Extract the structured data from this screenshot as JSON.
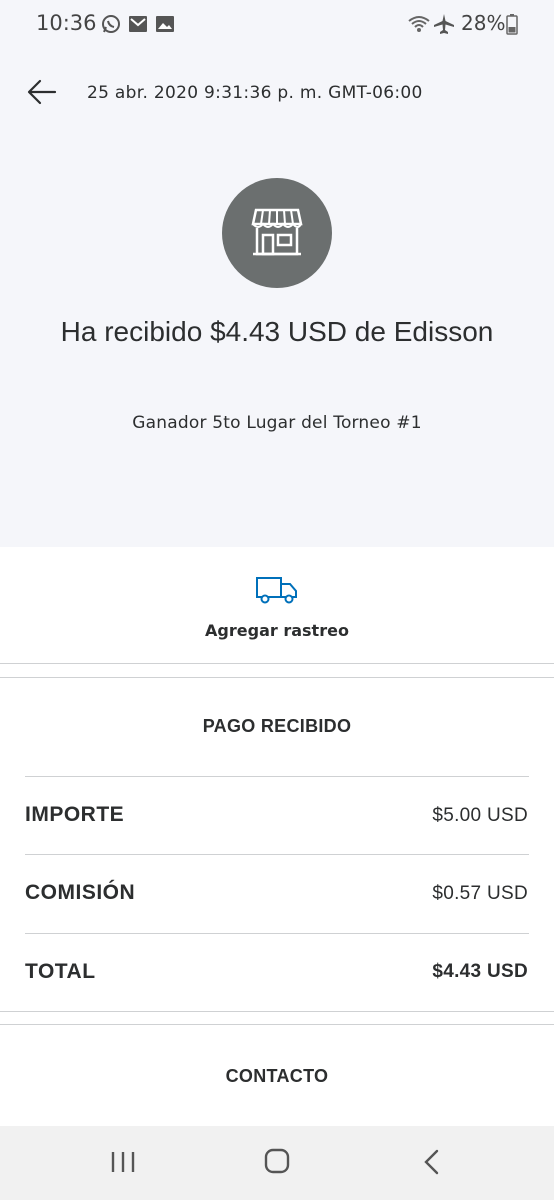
{
  "status_bar": {
    "time": "10:36",
    "battery": "28%",
    "icons": [
      "whatsapp-icon",
      "email-icon",
      "gallery-icon",
      "wifi-icon",
      "airplane-icon",
      "battery-icon"
    ]
  },
  "header": {
    "date": "25 abr. 2020 9:31:36 p. m. GMT-06:00",
    "back_icon": "arrow-left-icon"
  },
  "transaction": {
    "merchant_icon": "storefront-icon",
    "title": "Ha recibido $4.43 USD de Edisson",
    "note": "Ganador 5to Lugar del Torneo #1"
  },
  "tracking": {
    "icon": "truck-icon",
    "label": "Agregar rastreo",
    "accent_color": "#0070ba"
  },
  "payment": {
    "section_title": "PAGO RECIBIDO",
    "rows": [
      {
        "label": "IMPORTE",
        "value": "$5.00 USD"
      },
      {
        "label": "COMISIÓN",
        "value": "$0.57 USD"
      },
      {
        "label": "TOTAL",
        "value": "$4.43 USD"
      }
    ]
  },
  "contact": {
    "section_title": "CONTACTO"
  },
  "nav_bar": {
    "icons": [
      "recent-apps-icon",
      "home-icon",
      "back-nav-icon"
    ]
  },
  "colors": {
    "header_bg": "#f5f6fa",
    "avatar_bg": "#6b6f6f",
    "text": "#2c2e2f"
  }
}
